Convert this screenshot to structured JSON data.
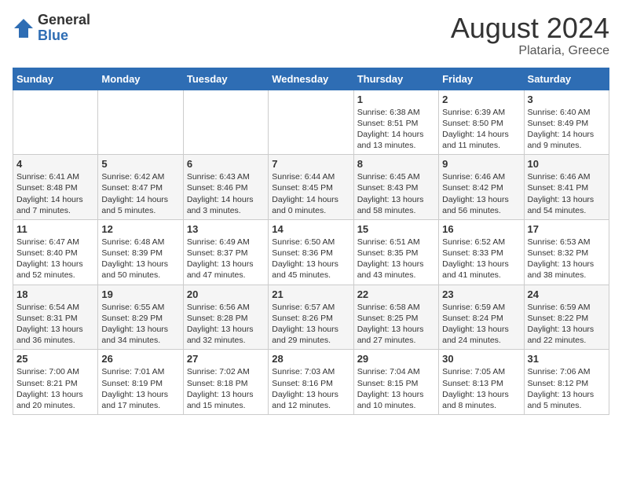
{
  "logo": {
    "general": "General",
    "blue": "Blue"
  },
  "header": {
    "title": "August 2024",
    "subtitle": "Plataria, Greece"
  },
  "calendar": {
    "headers": [
      "Sunday",
      "Monday",
      "Tuesday",
      "Wednesday",
      "Thursday",
      "Friday",
      "Saturday"
    ],
    "weeks": [
      [
        {
          "day": "",
          "info": ""
        },
        {
          "day": "",
          "info": ""
        },
        {
          "day": "",
          "info": ""
        },
        {
          "day": "",
          "info": ""
        },
        {
          "day": "1",
          "info": "Sunrise: 6:38 AM\nSunset: 8:51 PM\nDaylight: 14 hours\nand 13 minutes."
        },
        {
          "day": "2",
          "info": "Sunrise: 6:39 AM\nSunset: 8:50 PM\nDaylight: 14 hours\nand 11 minutes."
        },
        {
          "day": "3",
          "info": "Sunrise: 6:40 AM\nSunset: 8:49 PM\nDaylight: 14 hours\nand 9 minutes."
        }
      ],
      [
        {
          "day": "4",
          "info": "Sunrise: 6:41 AM\nSunset: 8:48 PM\nDaylight: 14 hours\nand 7 minutes."
        },
        {
          "day": "5",
          "info": "Sunrise: 6:42 AM\nSunset: 8:47 PM\nDaylight: 14 hours\nand 5 minutes."
        },
        {
          "day": "6",
          "info": "Sunrise: 6:43 AM\nSunset: 8:46 PM\nDaylight: 14 hours\nand 3 minutes."
        },
        {
          "day": "7",
          "info": "Sunrise: 6:44 AM\nSunset: 8:45 PM\nDaylight: 14 hours\nand 0 minutes."
        },
        {
          "day": "8",
          "info": "Sunrise: 6:45 AM\nSunset: 8:43 PM\nDaylight: 13 hours\nand 58 minutes."
        },
        {
          "day": "9",
          "info": "Sunrise: 6:46 AM\nSunset: 8:42 PM\nDaylight: 13 hours\nand 56 minutes."
        },
        {
          "day": "10",
          "info": "Sunrise: 6:46 AM\nSunset: 8:41 PM\nDaylight: 13 hours\nand 54 minutes."
        }
      ],
      [
        {
          "day": "11",
          "info": "Sunrise: 6:47 AM\nSunset: 8:40 PM\nDaylight: 13 hours\nand 52 minutes."
        },
        {
          "day": "12",
          "info": "Sunrise: 6:48 AM\nSunset: 8:39 PM\nDaylight: 13 hours\nand 50 minutes."
        },
        {
          "day": "13",
          "info": "Sunrise: 6:49 AM\nSunset: 8:37 PM\nDaylight: 13 hours\nand 47 minutes."
        },
        {
          "day": "14",
          "info": "Sunrise: 6:50 AM\nSunset: 8:36 PM\nDaylight: 13 hours\nand 45 minutes."
        },
        {
          "day": "15",
          "info": "Sunrise: 6:51 AM\nSunset: 8:35 PM\nDaylight: 13 hours\nand 43 minutes."
        },
        {
          "day": "16",
          "info": "Sunrise: 6:52 AM\nSunset: 8:33 PM\nDaylight: 13 hours\nand 41 minutes."
        },
        {
          "day": "17",
          "info": "Sunrise: 6:53 AM\nSunset: 8:32 PM\nDaylight: 13 hours\nand 38 minutes."
        }
      ],
      [
        {
          "day": "18",
          "info": "Sunrise: 6:54 AM\nSunset: 8:31 PM\nDaylight: 13 hours\nand 36 minutes."
        },
        {
          "day": "19",
          "info": "Sunrise: 6:55 AM\nSunset: 8:29 PM\nDaylight: 13 hours\nand 34 minutes."
        },
        {
          "day": "20",
          "info": "Sunrise: 6:56 AM\nSunset: 8:28 PM\nDaylight: 13 hours\nand 32 minutes."
        },
        {
          "day": "21",
          "info": "Sunrise: 6:57 AM\nSunset: 8:26 PM\nDaylight: 13 hours\nand 29 minutes."
        },
        {
          "day": "22",
          "info": "Sunrise: 6:58 AM\nSunset: 8:25 PM\nDaylight: 13 hours\nand 27 minutes."
        },
        {
          "day": "23",
          "info": "Sunrise: 6:59 AM\nSunset: 8:24 PM\nDaylight: 13 hours\nand 24 minutes."
        },
        {
          "day": "24",
          "info": "Sunrise: 6:59 AM\nSunset: 8:22 PM\nDaylight: 13 hours\nand 22 minutes."
        }
      ],
      [
        {
          "day": "25",
          "info": "Sunrise: 7:00 AM\nSunset: 8:21 PM\nDaylight: 13 hours\nand 20 minutes."
        },
        {
          "day": "26",
          "info": "Sunrise: 7:01 AM\nSunset: 8:19 PM\nDaylight: 13 hours\nand 17 minutes."
        },
        {
          "day": "27",
          "info": "Sunrise: 7:02 AM\nSunset: 8:18 PM\nDaylight: 13 hours\nand 15 minutes."
        },
        {
          "day": "28",
          "info": "Sunrise: 7:03 AM\nSunset: 8:16 PM\nDaylight: 13 hours\nand 12 minutes."
        },
        {
          "day": "29",
          "info": "Sunrise: 7:04 AM\nSunset: 8:15 PM\nDaylight: 13 hours\nand 10 minutes."
        },
        {
          "day": "30",
          "info": "Sunrise: 7:05 AM\nSunset: 8:13 PM\nDaylight: 13 hours\nand 8 minutes."
        },
        {
          "day": "31",
          "info": "Sunrise: 7:06 AM\nSunset: 8:12 PM\nDaylight: 13 hours\nand 5 minutes."
        }
      ]
    ]
  }
}
